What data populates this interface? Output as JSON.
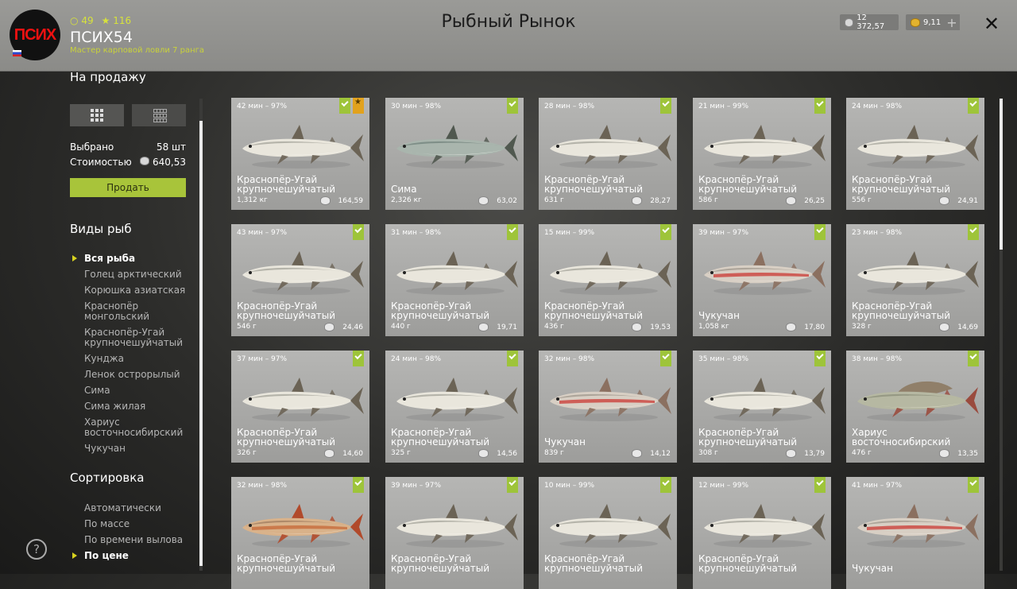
{
  "header": {
    "avatar_text": "ПСИХ",
    "stat_a": "49",
    "stat_b": "116",
    "player_name": "ПСИХ54",
    "player_rank": "Мастер карповой ловли 7 ранга",
    "title": "Рыбный Рынок",
    "silver": "12 372,57",
    "gold": "9,11",
    "plus": "+",
    "close": "✕"
  },
  "sidebar": {
    "for_sale_title": "На продажу",
    "selected_label": "Выбрано",
    "selected_value": "58 шт",
    "cost_label": "Стоимостью",
    "cost_value": "640,53",
    "sell_label": "Продать",
    "species_title": "Виды рыб",
    "species": [
      "Вся рыба",
      "Голец арктический",
      "Корюшка азиатская",
      "Краснопёр монгольский",
      "Краснопёр-Угай крупночешуйчатый",
      "Кунджа",
      "Ленок острорылый",
      "Сима",
      "Сима жилая",
      "Хариус восточносибирский",
      "Чукучан"
    ],
    "sort_title": "Сортировка",
    "sort": [
      "Автоматически",
      "По массе",
      "По времени вылова",
      "По цене"
    ],
    "help": "?"
  },
  "colors": {
    "accent": "#a8c43a",
    "badge_star": "#e2a21d"
  },
  "cards": [
    {
      "meta": "42 мин – 97%",
      "name": "Краснопёр-Угай крупночешуйчатый",
      "weight": "1,312 кг",
      "price": "164,59",
      "fish": "white",
      "star": true
    },
    {
      "meta": "30 мин – 98%",
      "name": "Сима",
      "weight": "2,326 кг",
      "price": "63,02",
      "fish": "salmon",
      "star": false
    },
    {
      "meta": "28 мин – 98%",
      "name": "Краснопёр-Угай крупночешуйчатый",
      "weight": "631 г",
      "price": "28,27",
      "fish": "white",
      "star": false
    },
    {
      "meta": "21 мин – 99%",
      "name": "Краснопёр-Угай крупночешуйчатый",
      "weight": "586 г",
      "price": "26,25",
      "fish": "white",
      "star": false
    },
    {
      "meta": "24 мин – 98%",
      "name": "Краснопёр-Угай крупночешуйчатый",
      "weight": "556 г",
      "price": "24,91",
      "fish": "white",
      "star": false
    },
    {
      "meta": "43 мин – 97%",
      "name": "Краснопёр-Угай крупночешуйчатый",
      "weight": "546 г",
      "price": "24,46",
      "fish": "white",
      "star": false
    },
    {
      "meta": "31 мин – 98%",
      "name": "Краснопёр-Угай крупночешуйчатый",
      "weight": "440 г",
      "price": "19,71",
      "fish": "white",
      "star": false
    },
    {
      "meta": "15 мин – 99%",
      "name": "Краснопёр-Угай крупночешуйчатый",
      "weight": "436 г",
      "price": "19,53",
      "fish": "white",
      "star": false
    },
    {
      "meta": "39 мин – 97%",
      "name": "Чукучан",
      "weight": "1,058 кг",
      "price": "17,80",
      "fish": "red",
      "star": false
    },
    {
      "meta": "23 мин – 98%",
      "name": "Краснопёр-Угай крупночешуйчатый",
      "weight": "328 г",
      "price": "14,69",
      "fish": "white",
      "star": false
    },
    {
      "meta": "37 мин – 97%",
      "name": "Краснопёр-Угай крупночешуйчатый",
      "weight": "326 г",
      "price": "14,60",
      "fish": "white",
      "star": false
    },
    {
      "meta": "24 мин – 98%",
      "name": "Краснопёр-Угай крупночешуйчатый",
      "weight": "325 г",
      "price": "14,56",
      "fish": "white",
      "star": false
    },
    {
      "meta": "32 мин – 98%",
      "name": "Чукучан",
      "weight": "839 г",
      "price": "14,12",
      "fish": "red",
      "star": false
    },
    {
      "meta": "35 мин – 98%",
      "name": "Краснопёр-Угай крупночешуйчатый",
      "weight": "308 г",
      "price": "13,79",
      "fish": "white",
      "star": false
    },
    {
      "meta": "38 мин – 98%",
      "name": "Хариус восточносибирский",
      "weight": "476 г",
      "price": "13,35",
      "fish": "grayling",
      "star": false
    },
    {
      "meta": "32 мин – 98%",
      "name": "Краснопёр-Угай крупночешуйчатый",
      "weight": "",
      "price": "",
      "fish": "orange",
      "star": false
    },
    {
      "meta": "39 мин – 97%",
      "name": "Краснопёр-Угай крупночешуйчатый",
      "weight": "",
      "price": "",
      "fish": "white",
      "star": false
    },
    {
      "meta": "10 мин – 99%",
      "name": "Краснопёр-Угай крупночешуйчатый",
      "weight": "",
      "price": "",
      "fish": "white",
      "star": false
    },
    {
      "meta": "12 мин – 99%",
      "name": "Краснопёр-Угай крупночешуйчатый",
      "weight": "",
      "price": "",
      "fish": "white",
      "star": false
    },
    {
      "meta": "41 мин – 97%",
      "name": "Чукучан",
      "weight": "",
      "price": "",
      "fish": "red",
      "star": false
    }
  ]
}
